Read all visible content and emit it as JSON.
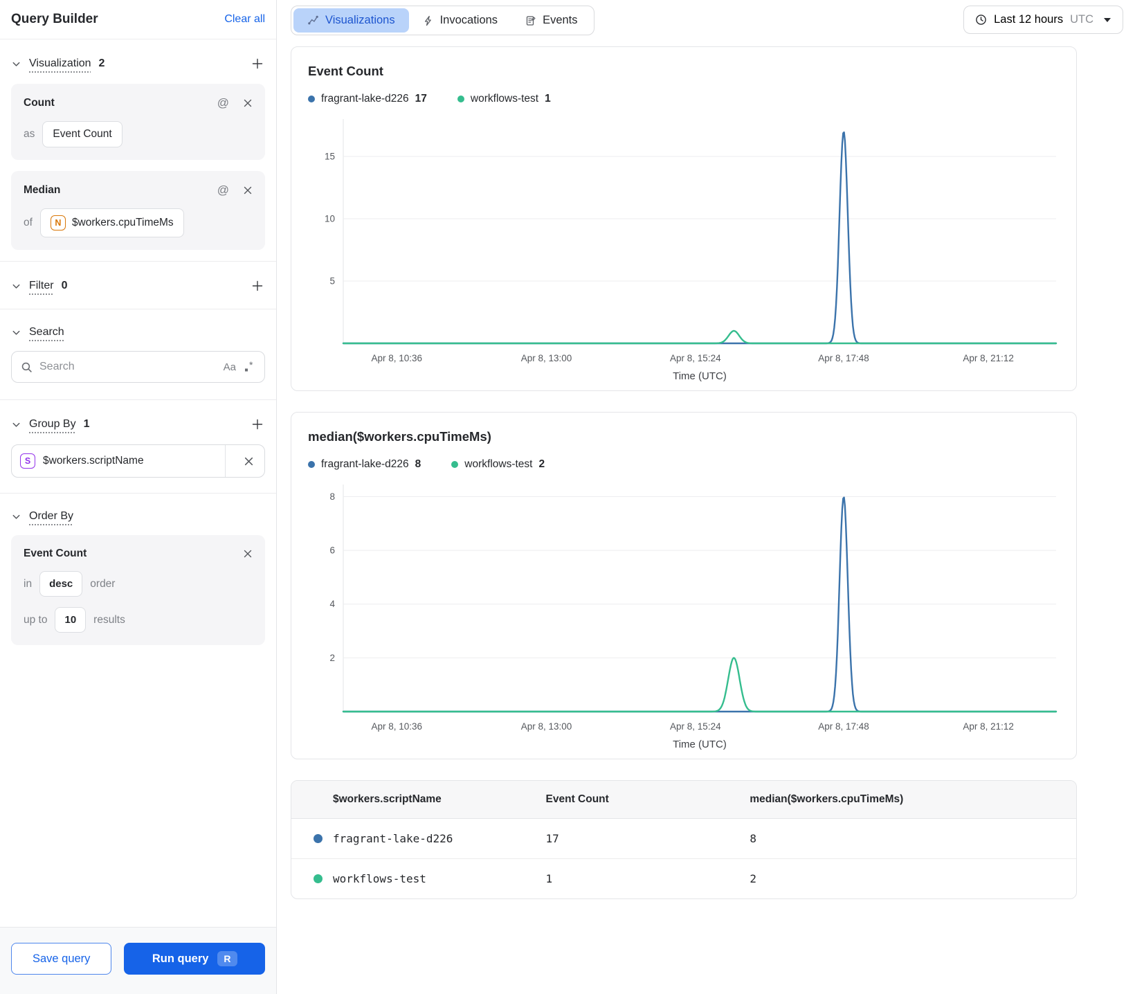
{
  "sidebar": {
    "title": "Query Builder",
    "clear_all": "Clear all",
    "visualization": {
      "label": "Visualization",
      "count": "2",
      "cards": [
        {
          "title": "Count",
          "prefix": "as",
          "value": "Event Count"
        },
        {
          "title": "Median",
          "prefix": "of",
          "field_icon": "N",
          "value": "$workers.cpuTimeMs"
        }
      ]
    },
    "filter": {
      "label": "Filter",
      "count": "0"
    },
    "search": {
      "label": "Search",
      "placeholder": "Search",
      "match_case_icon": "Aa"
    },
    "group_by": {
      "label": "Group By",
      "count": "1",
      "chip": {
        "icon": "S",
        "value": "$workers.scriptName"
      }
    },
    "order_by": {
      "label": "Order By",
      "card": {
        "field": "Event Count",
        "in_label": "in",
        "direction": "desc",
        "order_label": "order",
        "up_to_label": "up to",
        "limit": "10",
        "results_label": "results"
      }
    },
    "footer": {
      "save": "Save query",
      "run": "Run query",
      "shortcut": "R"
    }
  },
  "topbar": {
    "tabs": [
      {
        "label": "Visualizations",
        "selected": true
      },
      {
        "label": "Invocations",
        "selected": false
      },
      {
        "label": "Events",
        "selected": false
      }
    ],
    "time_range": {
      "range": "Last 12 hours",
      "timezone": "UTC"
    }
  },
  "colors": {
    "series_blue": "#3b73ab",
    "series_green": "#35bd8e",
    "primary_blue": "#1663e8",
    "tab_selected_bg": "#b9d3fa"
  },
  "chart_data": [
    {
      "type": "line",
      "title": "Event Count",
      "xlabel": "Time (UTC)",
      "x_tick_labels": [
        "Apr 8, 10:36",
        "Apr 8, 13:00",
        "Apr 8, 15:24",
        "Apr 8, 17:48",
        "Apr 8, 21:12"
      ],
      "x_tick_fracs": [
        0.075,
        0.285,
        0.494,
        0.702,
        0.905
      ],
      "y_ticks": [
        5,
        10,
        15
      ],
      "ylim": [
        0,
        18
      ],
      "grid": true,
      "legend_position": "top",
      "series": [
        {
          "name": "fragrant-lake-d226",
          "color": "#3b73ab",
          "total": 17,
          "baseline": 0,
          "spikes": [
            {
              "x_frac": 0.702,
              "time_approx": "Apr 8, 17:48",
              "value": 17,
              "spread": 0.0058
            }
          ]
        },
        {
          "name": "workflows-test",
          "color": "#35bd8e",
          "total": 1,
          "baseline": 0,
          "spikes": [
            {
              "x_frac": 0.548,
              "time_approx": "Apr 8, 15:45",
              "value": 1,
              "spread": 0.0075
            }
          ]
        }
      ]
    },
    {
      "type": "line",
      "title": "median($workers.cpuTimeMs)",
      "xlabel": "Time (UTC)",
      "x_tick_labels": [
        "Apr 8, 10:36",
        "Apr 8, 13:00",
        "Apr 8, 15:24",
        "Apr 8, 17:48",
        "Apr 8, 21:12"
      ],
      "x_tick_fracs": [
        0.075,
        0.285,
        0.494,
        0.702,
        0.905
      ],
      "y_ticks": [
        2,
        4,
        6,
        8
      ],
      "ylim": [
        0,
        8.45
      ],
      "grid": true,
      "legend_position": "top",
      "series": [
        {
          "name": "fragrant-lake-d226",
          "color": "#3b73ab",
          "total": 8,
          "baseline": 0,
          "spikes": [
            {
              "x_frac": 0.702,
              "time_approx": "Apr 8, 17:48",
              "value": 8,
              "spread": 0.0058
            }
          ]
        },
        {
          "name": "workflows-test",
          "color": "#35bd8e",
          "total": 2,
          "baseline": 0,
          "spikes": [
            {
              "x_frac": 0.548,
              "time_approx": "Apr 8, 15:45",
              "value": 2,
              "spread": 0.008
            }
          ]
        }
      ]
    }
  ],
  "table": {
    "headers": [
      "$workers.scriptName",
      "Event Count",
      "median($workers.cpuTimeMs)"
    ],
    "rows": [
      {
        "color": "#3b73ab",
        "script_name": "fragrant-lake-d226",
        "event_count": "17",
        "median": "8"
      },
      {
        "color": "#35bd8e",
        "script_name": "workflows-test",
        "event_count": "1",
        "median": "2"
      }
    ]
  }
}
